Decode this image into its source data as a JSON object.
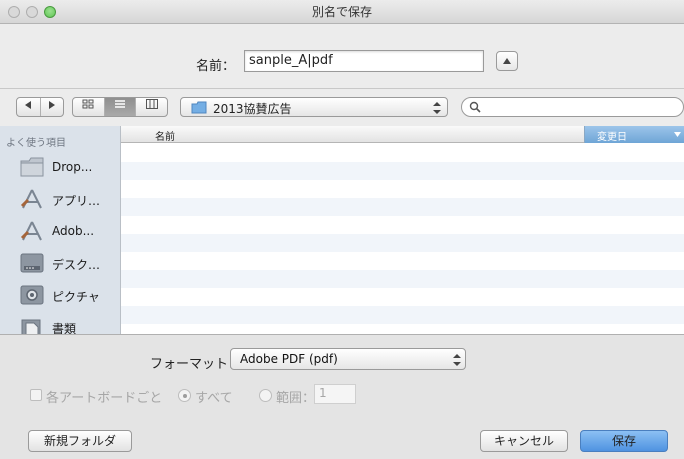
{
  "window": {
    "title": "別名で保存",
    "traffic_lights": [
      "close",
      "minimize",
      "zoom"
    ]
  },
  "save_as": {
    "label": "名前：",
    "filename": "sanple_A|pdf",
    "expand_icon": "chevron-up-icon"
  },
  "toolbar": {
    "back_icon": "chevron-left-icon",
    "forward_icon": "chevron-right-icon",
    "view_icons": [
      "icon-view-icon",
      "list-view-icon",
      "column-view-icon"
    ],
    "active_view": "list",
    "location": "2013協賛広告",
    "search_placeholder": ""
  },
  "sidebar": {
    "header": "よく使う項目",
    "items": [
      {
        "label": "Drop...",
        "icon": "folder-icon"
      },
      {
        "label": "アプリ…",
        "icon": "applications-icon"
      },
      {
        "label": "Adob...",
        "icon": "applications-icon"
      },
      {
        "label": "デスク…",
        "icon": "desktop-icon"
      },
      {
        "label": "ピクチャ",
        "icon": "camera-icon"
      },
      {
        "label": "書類",
        "icon": "documents-icon"
      }
    ]
  },
  "file_list": {
    "columns": [
      "名前",
      "変更日"
    ],
    "sorted_column": "変更日",
    "rows": []
  },
  "options": {
    "format_label": "フォーマット：",
    "format_value": "Adobe PDF (pdf)",
    "per_artboard_label": "各アートボードごと",
    "all_label": "すべて",
    "range_label": "範囲：",
    "range_value": "1"
  },
  "buttons": {
    "new_folder": "新規フォルダ",
    "cancel": "キャンセル",
    "save": "保存"
  },
  "colors": {
    "accent": "#5b9de6",
    "sidebar_bg": "#dbe2ea",
    "close": "#f3615b",
    "minimize": "#f6be4f",
    "zoom": "#5fc754"
  }
}
